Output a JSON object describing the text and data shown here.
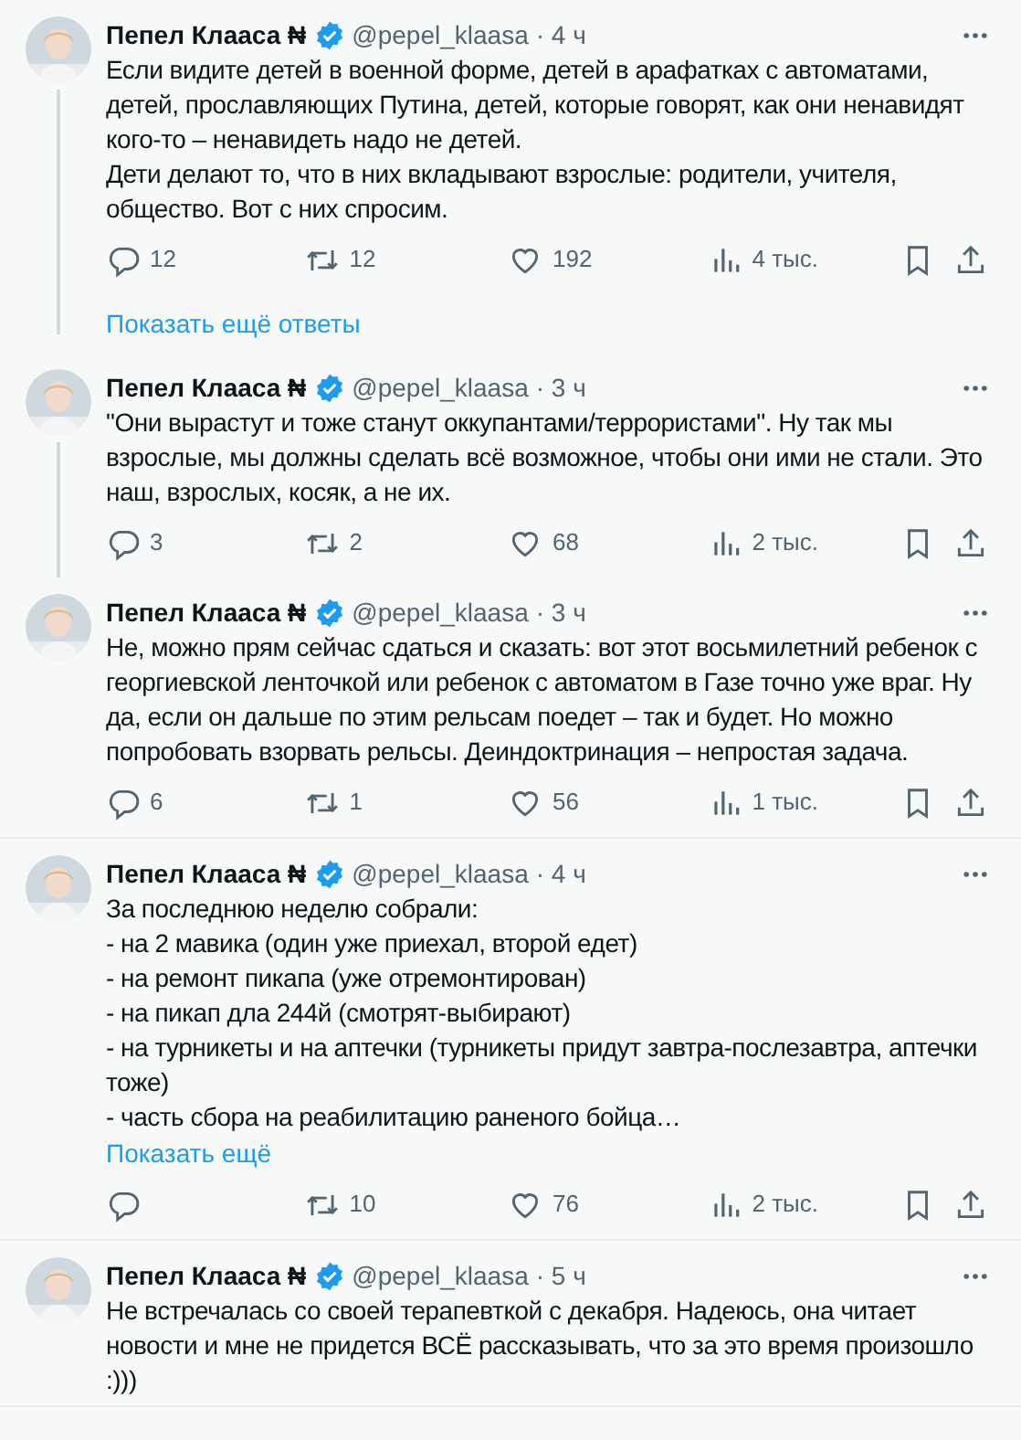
{
  "tweets": [
    {
      "name": "Пепел Клааса ₦",
      "verified": true,
      "handle": "@pepel_klaasa",
      "time": "· 4 ч",
      "text": "Если видите детей в военной форме, детей в арафатках с автоматами, детей, прославляющих Путина, детей, которые говорят, как они ненавидят кого-то – ненавидеть надо не детей.\nДети делают то, что в них вкладывают взрослые: родители, учителя, общество. Вот с них спросим.",
      "thread": true,
      "replies": "12",
      "reposts": "12",
      "likes": "192",
      "views": "4 тыс.",
      "show_more_replies": "Показать ещё ответы"
    },
    {
      "name": "Пепел Клааса ₦",
      "verified": true,
      "handle": "@pepel_klaasa",
      "time": "· 3 ч",
      "text": "\"Они вырастут и тоже станут оккупантами/террористами\". Ну так мы взрослые, мы должны сделать всё возможное, чтобы они ими не стали. Это наш, взрослых, косяк, а не их.",
      "thread": true,
      "replies": "3",
      "reposts": "2",
      "likes": "68",
      "views": "2 тыс."
    },
    {
      "name": "Пепел Клааса ₦",
      "verified": true,
      "handle": "@pepel_klaasa",
      "time": "· 3 ч",
      "text": "Не, можно прям сейчас сдаться и сказать: вот этот восьмилетний ребенок с георгиевской ленточкой или ребенок с автоматом в Газе точно уже враг. Ну да, если он дальше по этим рельсам поедет – так и будет. Но можно попробовать взорвать рельсы. Деиндоктринация – непростая задача.",
      "thread": false,
      "replies": "6",
      "reposts": "1",
      "likes": "56",
      "views": "1 тыс."
    },
    {
      "name": "Пепел Клааса ₦",
      "verified": true,
      "handle": "@pepel_klaasa",
      "time": "· 4 ч",
      "text": "За последнюю неделю собрали:\n- на 2 мавика (один уже приехал, второй едет)\n- на ремонт пикапа (уже отремонтирован)\n- на пикап дла 244й (смотрят-выбирают)\n- на турникеты и на аптечки (турникеты придут завтра-послезавтра, аптечки тоже)\n- часть сбора на реабилитацию раненого бойца…",
      "show_more": "Показать ещё",
      "thread": false,
      "reposts": "10",
      "likes": "76",
      "views": "2 тыс."
    },
    {
      "name": "Пепел Клааса ₦",
      "verified": true,
      "handle": "@pepel_klaasa",
      "time": "· 5 ч",
      "text": "Не встречалась со своей терапевткой с декабря. Надеюсь, она читает новости и мне не придется ВСЁ рассказывать, что за это время произошло :)))",
      "thread": false
    }
  ]
}
